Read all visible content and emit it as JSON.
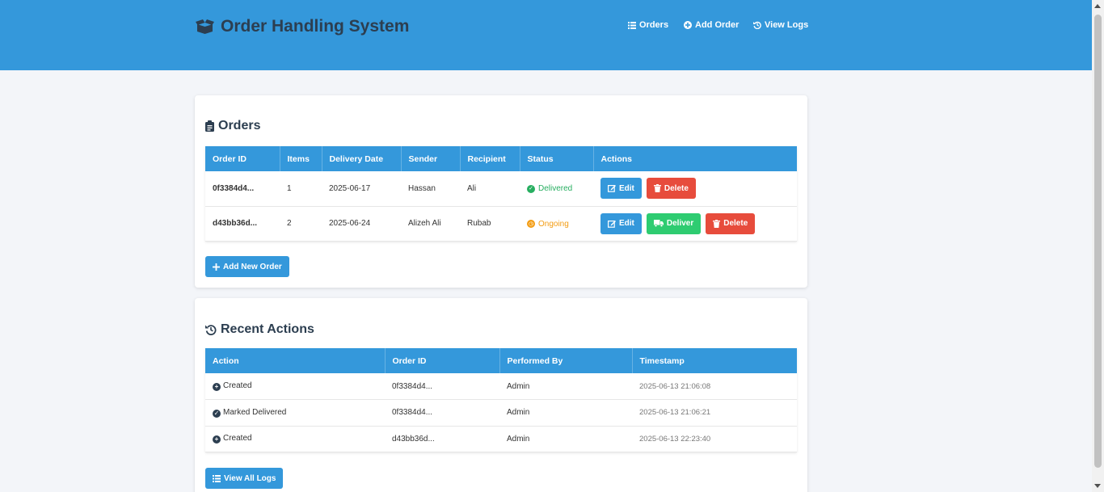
{
  "header": {
    "title": "Order Handling System",
    "nav": [
      {
        "label": "Orders",
        "icon": "list-icon"
      },
      {
        "label": "Add Order",
        "icon": "plus-circle-icon"
      },
      {
        "label": "View Logs",
        "icon": "history-icon"
      }
    ]
  },
  "orders": {
    "title": "Orders",
    "columns": [
      "Order ID",
      "Items",
      "Delivery Date",
      "Sender",
      "Recipient",
      "Status",
      "Actions"
    ],
    "rows": [
      {
        "id": "0f3384d4...",
        "items": "1",
        "date": "2025-06-17",
        "sender": "Hassan",
        "recipient": "Ali",
        "status": "Delivered"
      },
      {
        "id": "d43bb36d...",
        "items": "2",
        "date": "2025-06-24",
        "sender": "Alizeh Ali",
        "recipient": "Rubab",
        "status": "Ongoing"
      }
    ],
    "actions": {
      "edit": "Edit",
      "delete": "Delete",
      "deliver": "Deliver"
    },
    "add_button": "Add New Order"
  },
  "logs": {
    "title": "Recent Actions",
    "columns": [
      "Action",
      "Order ID",
      "Performed By",
      "Timestamp"
    ],
    "rows": [
      {
        "action": "Created",
        "order_id": "0f3384d4...",
        "by": "Admin",
        "timestamp": "2025-06-13 21:06:08"
      },
      {
        "action": "Marked Delivered",
        "order_id": "0f3384d4...",
        "by": "Admin",
        "timestamp": "2025-06-13 21:06:21"
      },
      {
        "action": "Created",
        "order_id": "d43bb36d...",
        "by": "Admin",
        "timestamp": "2025-06-13 22:23:40"
      }
    ],
    "view_all_button": "View All Logs"
  },
  "colors": {
    "header": "#3498db",
    "primary": "#3498db",
    "danger": "#e74c3c",
    "success": "#2ecc71",
    "delivered": "#27ae60",
    "ongoing": "#f39c12",
    "text": "#2c3e50"
  }
}
